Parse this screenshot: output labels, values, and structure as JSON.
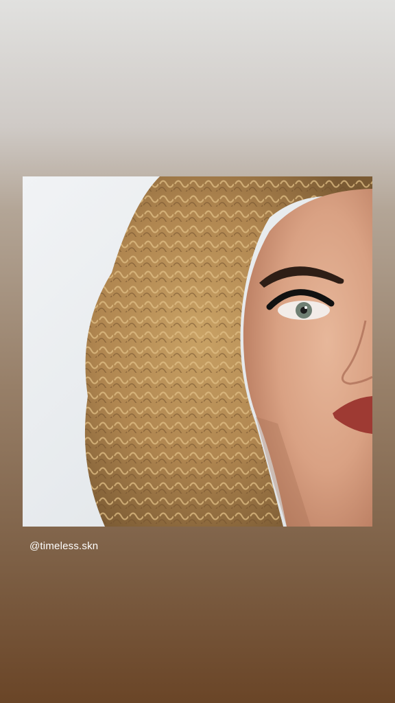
{
  "story": {
    "photo": {
      "description_icon": "portrait-photo"
    },
    "caption": {
      "mention": "@timeless.skn"
    }
  }
}
